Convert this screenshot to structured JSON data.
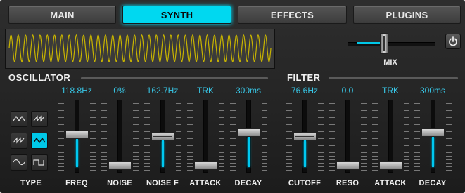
{
  "tabs": [
    {
      "label": "MAIN",
      "active": false
    },
    {
      "label": "SYNTH",
      "active": true
    },
    {
      "label": "EFFECTS",
      "active": false
    },
    {
      "label": "PLUGINS",
      "active": false
    }
  ],
  "mix": {
    "label": "MIX",
    "value_fraction": 0.4
  },
  "power": {
    "icon": "power-icon"
  },
  "oscillator": {
    "title": "OSCILLATOR",
    "type_label": "TYPE",
    "types": [
      {
        "icon": "triangle-wave-icon",
        "selected": false
      },
      {
        "icon": "saw-up-wave-icon",
        "selected": false
      },
      {
        "icon": "saw-down-wave-icon",
        "selected": false
      },
      {
        "icon": "triangle-saw-wave-icon",
        "selected": true
      },
      {
        "icon": "sine-wave-icon",
        "selected": false
      },
      {
        "icon": "square-wave-icon",
        "selected": false
      }
    ],
    "faders": [
      {
        "label": "FREQ",
        "value": "118.8Hz",
        "level": 0.58
      },
      {
        "label": "NOISE",
        "value": "0%",
        "level": 0.0
      },
      {
        "label": "NOISE F",
        "value": "162.7Hz",
        "level": 0.55
      },
      {
        "label": "ATTACK",
        "value": "TRK",
        "level": 0.0
      },
      {
        "label": "DECAY",
        "value": "300ms",
        "level": 0.62
      }
    ]
  },
  "filter": {
    "title": "FILTER",
    "faders": [
      {
        "label": "CUTOFF",
        "value": "76.6Hz",
        "level": 0.55
      },
      {
        "label": "RESO",
        "value": "0.0",
        "level": 0.0
      },
      {
        "label": "ATTACK",
        "value": "TRK",
        "level": 0.0
      },
      {
        "label": "DECAY",
        "value": "300ms",
        "level": 0.62
      }
    ]
  },
  "colors": {
    "accent": "#00d8f0",
    "waveform": "#c8b400",
    "value_text": "#38c8e8"
  }
}
